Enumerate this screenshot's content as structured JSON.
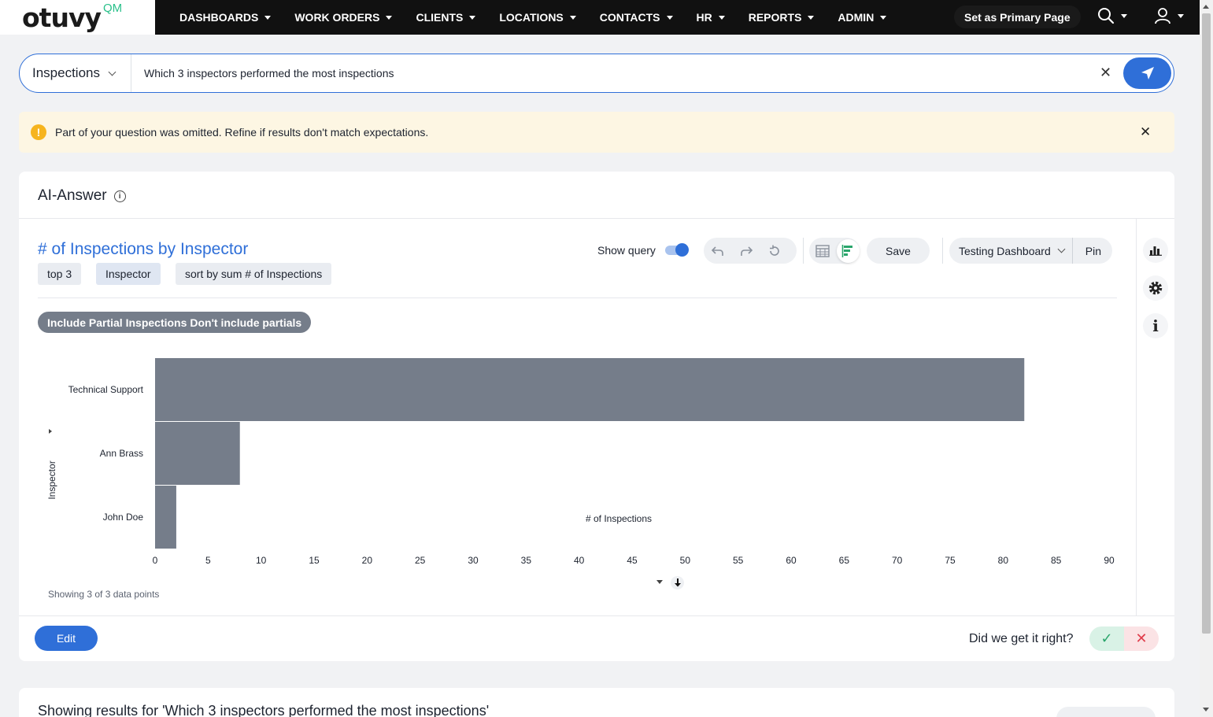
{
  "brand": {
    "logo_text": "otuvy",
    "logo_suffix": "QM"
  },
  "nav": {
    "items": [
      "DASHBOARDS",
      "WORK ORDERS",
      "CLIENTS",
      "LOCATIONS",
      "CONTACTS",
      "HR",
      "REPORTS",
      "ADMIN"
    ],
    "primary_label": "Set as Primary Page"
  },
  "search": {
    "scope": "Inspections",
    "query": "Which 3 inspectors performed the most inspections"
  },
  "warning": {
    "text": "Part of your question was omitted. Refine if results don't match expectations."
  },
  "answer": {
    "title": "AI-Answer",
    "viz_title": "# of Inspections by Inspector",
    "chips": [
      "top 3",
      "Inspector",
      "sort by sum # of Inspections"
    ],
    "show_query_label": "Show query",
    "save_label": "Save",
    "dashboard": "Testing Dashboard",
    "pin_label": "Pin",
    "filter": {
      "name": "Include Partial Inspections",
      "value": "Don't include partials"
    },
    "showing": "Showing 3 of 3 data points",
    "edit_label": "Edit",
    "feedback_label": "Did we get it right?"
  },
  "chart_data": {
    "type": "bar",
    "orientation": "horizontal",
    "categories": [
      "Technical Support",
      "Ann Brass",
      "John Doe"
    ],
    "values": [
      82,
      8,
      2
    ],
    "xlabel": "# of Inspections",
    "ylabel": "Inspector",
    "xlim": [
      0,
      90
    ],
    "xticks": [
      0,
      5,
      10,
      15,
      20,
      25,
      30,
      35,
      40,
      45,
      50,
      55,
      60,
      65,
      70,
      75,
      80,
      85,
      90
    ],
    "bar_color": "#757d8a",
    "grid": false
  },
  "results": {
    "title": "Showing results for 'Which 3 inspectors performed the most inspections'"
  },
  "colors": {
    "accent": "#2f6fd8",
    "warning": "#f6b41e",
    "success": "#29a56b",
    "danger": "#e03c4b"
  }
}
